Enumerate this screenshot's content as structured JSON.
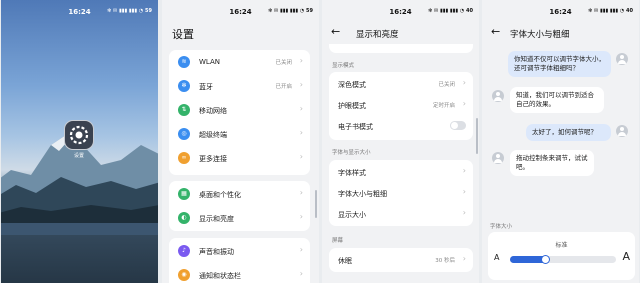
{
  "status_time": "16:24",
  "status_icons": "✻ ✉ ▮▮▮ ▮▮▮ ◔ 59",
  "status_icons_4": "✻ ✉ ▮▮▮ ▮▮▮ ◔ 40",
  "home": {
    "app_label": "设置"
  },
  "settings": {
    "title": "设置",
    "items": [
      {
        "label": "WLAN",
        "value": "已关闭",
        "icon": "wifi-icon",
        "color": "#3b8ef0",
        "glyph": "≋"
      },
      {
        "label": "蓝牙",
        "value": "已开启",
        "icon": "bluetooth-icon",
        "color": "#3b8ef0",
        "glyph": "✻"
      },
      {
        "label": "移动网络",
        "value": "",
        "icon": "mobile-network-icon",
        "color": "#34b36a",
        "glyph": "⇅"
      },
      {
        "label": "超级终端",
        "value": "",
        "icon": "super-device-icon",
        "color": "#3b8ef0",
        "glyph": "◎"
      },
      {
        "label": "更多连接",
        "value": "",
        "icon": "more-connections-icon",
        "color": "#f0a030",
        "glyph": "∞"
      },
      {
        "label": "桌面和个性化",
        "value": "",
        "icon": "desktop-icon",
        "color": "#34b36a",
        "glyph": "▦"
      },
      {
        "label": "显示和亮度",
        "value": "",
        "icon": "display-icon",
        "color": "#34b36a",
        "glyph": "◐"
      },
      {
        "label": "声音和振动",
        "value": "",
        "icon": "sound-icon",
        "color": "#7a5af0",
        "glyph": "♪"
      },
      {
        "label": "通知和状态栏",
        "value": "",
        "icon": "notification-icon",
        "color": "#f0a030",
        "glyph": "◉"
      }
    ]
  },
  "display": {
    "title": "显示和亮度",
    "section_mode": "显示模式",
    "dark_mode": "深色模式",
    "dark_mode_value": "已关闭",
    "eye_care": "护眼模式",
    "eye_care_value": "定时开启",
    "ebook_mode": "电子书模式",
    "ebook_mode_on": false,
    "section_font": "字体与显示大小",
    "font_style": "字体样式",
    "font_size_weight": "字体大小与粗细",
    "display_size": "显示大小",
    "section_screen": "屏幕",
    "sleep": "休眠",
    "sleep_value": "30 秒后"
  },
  "font_size": {
    "title": "字体大小与粗细",
    "messages": [
      {
        "from": "me",
        "text": "你知道不仅可以调节字体大小，还可调节字体粗细吗？"
      },
      {
        "from": "them",
        "text": "知道，我们可以调节到适合自己的效果。"
      },
      {
        "from": "me",
        "text": "太好了，如何调节呢？"
      },
      {
        "from": "them",
        "text": "拖动控制条来调节，试试吧。"
      }
    ],
    "section_label": "字体大小",
    "slider_label": "标准",
    "small_a": "A",
    "large_a": "A",
    "slider_level": 0.3,
    "accent_color": "#2e66d8"
  }
}
